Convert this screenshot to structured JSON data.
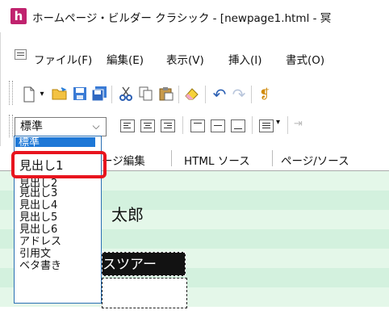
{
  "window": {
    "logo_glyph": "h",
    "title": "ホームページ・ビルダー クラシック - [newpage1.html - 冥"
  },
  "menu": [
    "ファイル(F)",
    "編集(E)",
    "表示(V)",
    "挿入(I)",
    "書式(O)"
  ],
  "format_bar": {
    "style_value": "標準"
  },
  "tabs": {
    "edit": "ージ編集",
    "html_source": "HTML ソース",
    "page_source": "ページ/ソース"
  },
  "style_options": [
    "標準",
    "見出し1",
    "見出し2",
    "見出し3",
    "見出し4",
    "見出し5",
    "見出し6",
    "アドレス",
    "引用文",
    "ベタ書き"
  ],
  "content": {
    "name_text": "太郎",
    "dark_block_text": "スツアー"
  },
  "colors": {
    "logo": "#c0226e",
    "highlight": "#e8141e",
    "editor_bg": "#e4f7e9",
    "dropdown_border": "#2a6fb3"
  },
  "icons": [
    "new-page-icon",
    "open-folder-icon",
    "save-icon",
    "save-all-icon",
    "cut-icon",
    "copy-icon",
    "paste-icon",
    "eraser-icon",
    "undo-icon",
    "redo-icon"
  ]
}
